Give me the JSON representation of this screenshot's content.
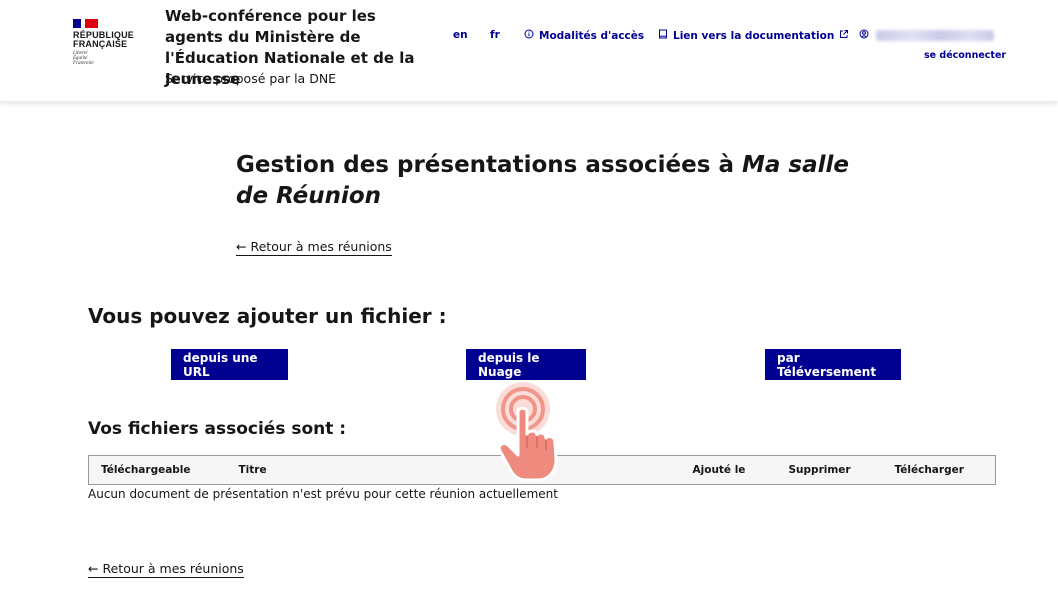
{
  "header": {
    "logo": {
      "line1": "RÉPUBLIQUE",
      "line2": "FRANÇAISE",
      "devise": [
        "Liberté",
        "Égalité",
        "Fraternité"
      ],
      "flag_colors": [
        "#000091",
        "#ffffff",
        "#e1000f"
      ]
    },
    "service_title": "Web-conférence pour les agents du Ministère de l'Éducation Nationale et de la Jeunesse",
    "service_tagline": "Service proposé par la DNE",
    "nav": {
      "lang_en": "en",
      "lang_fr": "fr",
      "access_label": "Modalités d'accès",
      "doc_label": "Lien vers la documentation",
      "logout_label": "se déconnecter"
    }
  },
  "main": {
    "title_prefix": "Gestion des présentations associées à ",
    "title_room": "Ma salle de Réunion",
    "back_link": "Retour à mes réunions",
    "add_heading": "Vous pouvez ajouter un fichier :",
    "buttons": {
      "url": "depuis une URL",
      "cloud": "depuis le Nuage",
      "upload": "par Téléversement"
    },
    "files_heading": "Vos fichiers associés sont :",
    "table": {
      "columns": [
        "Téléchargeable",
        "Titre",
        "Ajouté le",
        "Supprimer",
        "Télécharger"
      ]
    },
    "empty_message": "Aucun document de présentation n'est prévu pour cette réunion actuellement",
    "back_link_bottom": "Retour à mes réunions"
  },
  "colors": {
    "accent": "#000091",
    "text": "#161616",
    "hand": "#ef8a7e"
  }
}
